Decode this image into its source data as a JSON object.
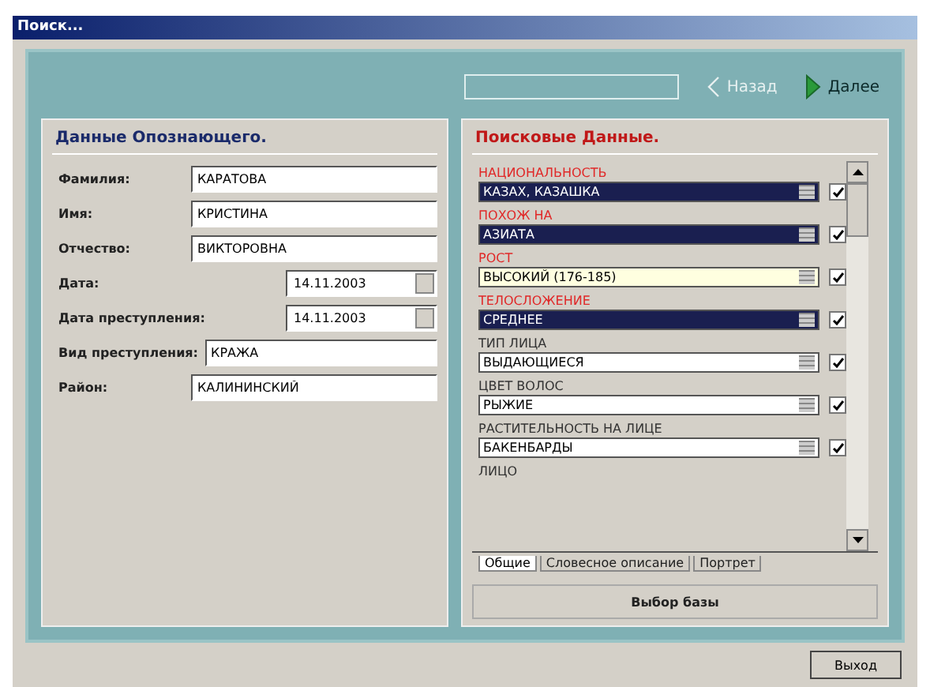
{
  "window": {
    "title": "Поиск..."
  },
  "toolbar": {
    "back": {
      "label": "Назад",
      "disabled": true
    },
    "next": {
      "label": "Далее",
      "disabled": false
    }
  },
  "left_panel": {
    "title": "Данные Опознающего.",
    "fields": [
      {
        "label": "Фамилия:",
        "value": "КАРАТОВА",
        "kind": "text"
      },
      {
        "label": "Имя:",
        "value": "КРИСТИНА",
        "kind": "text"
      },
      {
        "label": "Отчество:",
        "value": "ВИКТОРОВНА",
        "kind": "text"
      },
      {
        "label": "Дата:",
        "value": "14.11.2003",
        "kind": "date"
      },
      {
        "label": "Дата преступления:",
        "value": "14.11.2003",
        "kind": "date"
      },
      {
        "label": "Вид преступления:",
        "value": "КРАЖА",
        "kind": "text"
      },
      {
        "label": "Район:",
        "value": "КАЛИНИНСКИЙ",
        "kind": "text"
      }
    ]
  },
  "right_panel": {
    "title": "Поисковые Данные.",
    "items": [
      {
        "label": "НАЦИОНАЛЬНОСТЬ",
        "value": "КАЗАХ, КАЗАШКА",
        "active": true,
        "selected": true,
        "focused": false,
        "checked": true
      },
      {
        "label": "ПОХОЖ НА",
        "value": "АЗИАТА",
        "active": true,
        "selected": true,
        "focused": false,
        "checked": true
      },
      {
        "label": "РОСТ",
        "value": "ВЫСОКИЙ (176-185)",
        "active": true,
        "selected": false,
        "focused": true,
        "checked": true
      },
      {
        "label": "ТЕЛОСЛОЖЕНИЕ",
        "value": "СРЕДНЕЕ",
        "active": true,
        "selected": true,
        "focused": false,
        "checked": true
      },
      {
        "label": "ТИП ЛИЦА",
        "value": "ВЫДАЮЩИЕСЯ",
        "active": false,
        "selected": false,
        "focused": false,
        "checked": true
      },
      {
        "label": "ЦВЕТ ВОЛОС",
        "value": "РЫЖИЕ",
        "active": false,
        "selected": false,
        "focused": false,
        "checked": true
      },
      {
        "label": "РАСТИТЕЛЬНОСТЬ НА ЛИЦЕ",
        "value": "БАКЕНБАРДЫ",
        "active": false,
        "selected": false,
        "focused": false,
        "checked": true
      },
      {
        "label": "ЛИЦО",
        "active": false,
        "kind": "label_only"
      }
    ],
    "tabs": [
      {
        "label": "Общие",
        "selected": true
      },
      {
        "label": "Словесное описание",
        "selected": false
      },
      {
        "label": "Портрет",
        "selected": false
      }
    ],
    "button": "Выбор базы"
  },
  "footer": {
    "button": "Выход"
  }
}
